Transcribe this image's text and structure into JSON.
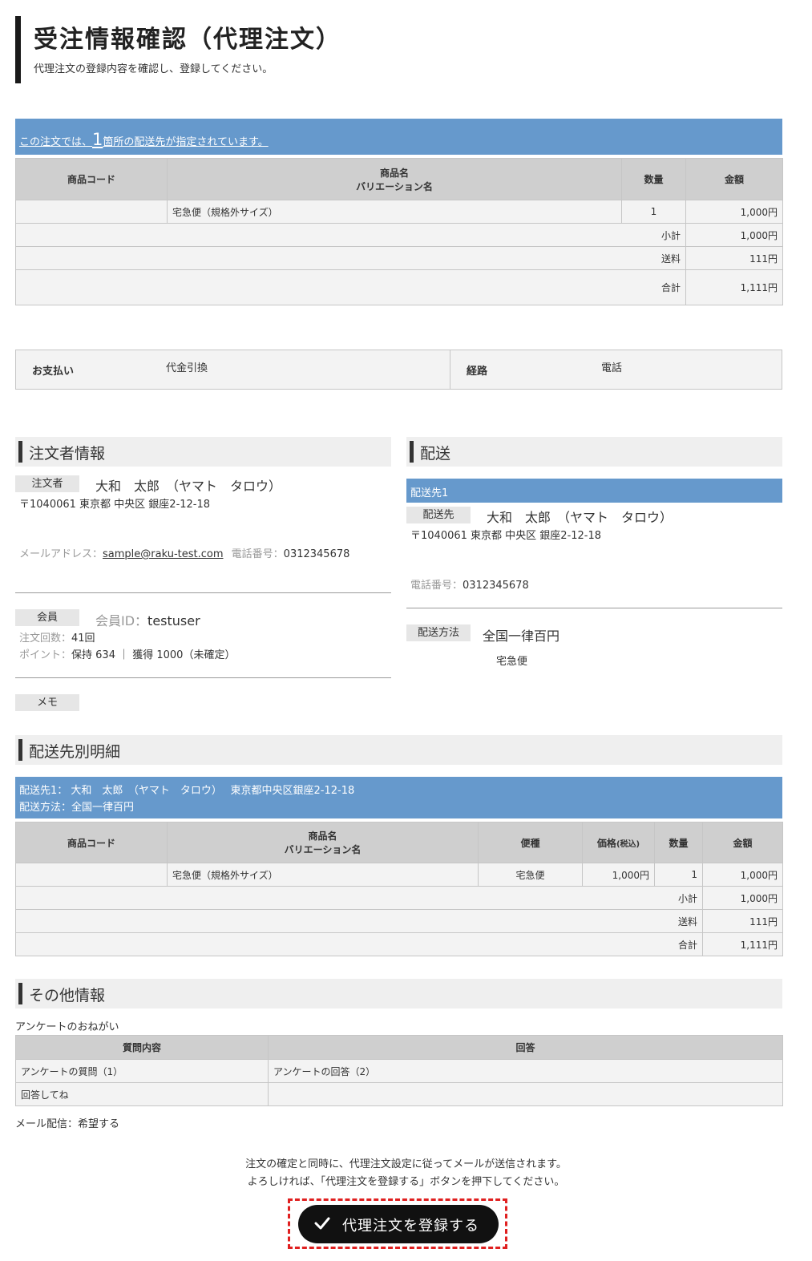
{
  "header": {
    "title": "受注情報確認（代理注文）",
    "subtitle": "代理注文の登録内容を確認し、登録してください。"
  },
  "notice": {
    "prefix": "この注文では、",
    "count": "1",
    "suffix": "箇所の配送先が指定されています。"
  },
  "order_table": {
    "headers": {
      "code": "商品コード",
      "name_line1": "商品名",
      "name_line2": "バリエーション名",
      "qty": "数量",
      "amount": "金額"
    },
    "item": {
      "code": "",
      "name": "宅急便（規格外サイズ）",
      "qty": "1",
      "amount": "1,000円"
    },
    "subtotal_label": "小計",
    "subtotal": "1,000円",
    "shipping_label": "送料",
    "shipping": "111円",
    "total_label": "合計",
    "total": "1,111円"
  },
  "payment": {
    "label": "お支払い",
    "value": "代金引換",
    "route_label": "経路",
    "route_value": "電話"
  },
  "customer": {
    "section_title": "注文者情報",
    "orderer_tag": "注文者",
    "name": "大和　太郎　（ヤマト　タロウ）",
    "address": "〒1040061  東京都  中央区  銀座2-12-18",
    "email_label": "メールアドレス：",
    "email": "sample@raku-test.com",
    "phone_label": "電話番号：",
    "phone": "0312345678",
    "member_tag": "会員",
    "member_id_label": "会員ID：",
    "member_id": "testuser",
    "order_count_label": "注文回数：",
    "order_count": "41回",
    "points_label": "ポイント：",
    "points": "保持 634 ｜ 獲得 1000（未確定）",
    "memo_tag": "メモ"
  },
  "shipping": {
    "section_title": "配送",
    "dest_title": "配送先1",
    "dest_tag": "配送先",
    "name": "大和　太郎　（ヤマト　タロウ）",
    "address": "〒1040061  東京都  中央区  銀座2-12-18",
    "phone_label": "電話番号：",
    "phone": "0312345678",
    "method_tag": "配送方法",
    "method": "全国一律百円",
    "carrier": "宅急便"
  },
  "detail": {
    "section_title": "配送先別明細",
    "banner_line1": "配送先1：  大和　太郎　（ヤマト　タロウ）　  東京都中央区銀座2-12-18",
    "banner_line2": "配送方法：全国一律百円",
    "headers": {
      "code": "商品コード",
      "name_line1": "商品名",
      "name_line2": "バリエーション名",
      "carrier": "便種",
      "price": "価格",
      "price_note": "(税込)",
      "qty": "数量",
      "amount": "金額"
    },
    "item": {
      "code": "",
      "name": "宅急便（規格外サイズ）",
      "carrier": "宅急便",
      "price": "1,000円",
      "qty": "1",
      "amount": "1,000円"
    },
    "subtotal_label": "小計",
    "subtotal": "1,000円",
    "shipping_label": "送料",
    "shipping": "111円",
    "total_label": "合計",
    "total": "1,111円"
  },
  "other": {
    "section_title": "その他情報",
    "survey_title": "アンケートのおねがい",
    "headers": {
      "question": "質問内容",
      "answer": "回答"
    },
    "rows": [
      {
        "question": "アンケートの質問（1）",
        "answer": "アンケートの回答（2）"
      },
      {
        "question": "回答してね",
        "answer": ""
      }
    ],
    "mail_label": "メール配信：",
    "mail_value": "希望する"
  },
  "footer": {
    "note_line1": "注文の確定と同時に、代理注文設定に従ってメールが送信されます。",
    "note_line2": "よろしければ、「代理注文を登録する」ボタンを押下してください。",
    "button_label": "代理注文を登録する"
  },
  "colors": {
    "accent_blue": "#6699cc",
    "button": "#111111",
    "highlight": "#e02020"
  }
}
